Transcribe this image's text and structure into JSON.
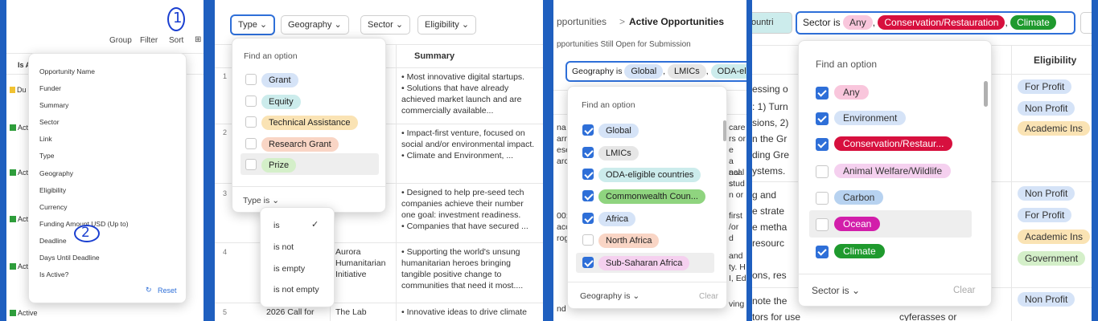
{
  "panel1": {
    "toolbar": {
      "group": "Group",
      "filter": "Filter",
      "sort": "Sort",
      "clip": "⊞"
    },
    "col_header": "Is A",
    "rows": [
      "Du",
      "Activ",
      "Activ",
      "Act",
      "Act",
      "Active"
    ],
    "menu_items": [
      "Opportunity Name",
      "Funder",
      "Summary",
      "Sector",
      "Link",
      "Type",
      "Geography",
      "Eligibility",
      "Currency",
      "Funding Amount USD (Up to)",
      "Deadline",
      "Days Until Deadline",
      "Is Active?"
    ],
    "reset": "Reset",
    "annotation1": "1",
    "annotation2": "2"
  },
  "panel2": {
    "filters": {
      "type": "Type",
      "geography": "Geography",
      "sector": "Sector",
      "eligibility": "Eligibility"
    },
    "summary_header": "Summary",
    "find_option": "Find an option",
    "options": [
      {
        "label": "Grant",
        "color": "#d5e3f7"
      },
      {
        "label": "Equity",
        "color": "#ccecec"
      },
      {
        "label": "Technical Assistance",
        "color": "#fae3b4"
      },
      {
        "label": "Research Grant",
        "color": "#f9d5c5"
      },
      {
        "label": "Prize",
        "color": "#d4efc9"
      }
    ],
    "type_is": "Type is",
    "operators": [
      "is",
      "is not",
      "is empty",
      "is not empty"
    ],
    "row_numbers": [
      "1",
      "2",
      "3",
      "4",
      "5"
    ],
    "summaries": [
      "• Most innovative digital startups.\n• Solutions that have already achieved market launch and are commercially available...",
      "• Impact-first venture, focused on social and/or environmental impact.\n• Climate and Environment, ...",
      "• Designed to help pre-seed tech companies achieve their number one goal: investment readiness.\n• Companies that have secured ...",
      "• Supporting the world's unsung humanitarian heroes bringing tangible positive change to communities that need it most....",
      "• Innovative ideas to drive climate"
    ],
    "row4_funder": "Aurora Humanitarian Initiative",
    "row5_name": "2026 Call for",
    "row5_funder": "The Lab"
  },
  "panel3": {
    "breadcrumb_prev": "pportunities",
    "breadcrumb_sep": ">",
    "breadcrumb_current": "Active Opportunities",
    "subtitle": "pportunities Still Open for Submission",
    "filter_prefix": "Geography is",
    "filter_chips": [
      "Global",
      "LMICs",
      "ODA-eli"
    ],
    "find_option": "Find an option",
    "col_frag": "ary",
    "left_frags": [
      "C",
      "na",
      "arm",
      "ese",
      "arc",
      "00:",
      "acce",
      "rog",
      "nd"
    ],
    "right_frags": [
      "care",
      "rs or",
      "e",
      "a acal",
      "nal s",
      "stud",
      "n or",
      "first",
      "/or",
      "d",
      "and",
      "ty. H",
      "I, Ed",
      "ving"
    ],
    "options": [
      {
        "label": "Global",
        "checked": true,
        "color": "#d5e3f7"
      },
      {
        "label": "LMICs",
        "checked": true,
        "color": "#e6e6e6"
      },
      {
        "label": "ODA-eligible countries",
        "checked": true,
        "color": "#ccecec"
      },
      {
        "label": "Commonwealth Coun...",
        "checked": true,
        "color": "#8fd47f"
      },
      {
        "label": "Africa",
        "checked": true,
        "color": "#d5e3f7"
      },
      {
        "label": "North Africa",
        "checked": false,
        "color": "#f9d5c5"
      },
      {
        "label": "Sub-Saharan Africa",
        "checked": true,
        "color": "#f5d0ef"
      }
    ],
    "footer_label": "Geography is",
    "clear": "Clear"
  },
  "panel4": {
    "prev_chip": "ountri",
    "filter_prefix": "Sector is",
    "filter_chips": [
      {
        "label": "Any",
        "color": "#f9c6dc"
      },
      {
        "label": "Conservation/Restauration",
        "color": "#d7103e"
      },
      {
        "label": "Climate",
        "color": "#1f9a2e"
      }
    ],
    "eligibility_header": "Eligibility",
    "find_option": "Find an option",
    "options": [
      {
        "label": "Any",
        "checked": true,
        "color": "#f9c6dc",
        "text_color": "#333"
      },
      {
        "label": "Environment",
        "checked": true,
        "color": "#d5e3f7",
        "text_color": "#333"
      },
      {
        "label": "Conservation/Restaur...",
        "checked": true,
        "color": "#d7103e",
        "text_color": "#ffffff"
      },
      {
        "label": "Animal Welfare/Wildlife",
        "checked": false,
        "color": "#f5d0ef",
        "text_color": "#333"
      },
      {
        "label": "Carbon",
        "checked": false,
        "color": "#b7d2f0",
        "text_color": "#333"
      },
      {
        "label": "Ocean",
        "checked": false,
        "color": "#d21eaa",
        "text_color": "#ffffff"
      },
      {
        "label": "Climate",
        "checked": true,
        "color": "#1f9a2e",
        "text_color": "#ffffff"
      }
    ],
    "footer_label": "Sector is",
    "clear": "Clear",
    "left_frags": [
      "essing o",
      ": 1) Turn",
      "sions, 2)",
      "n the Gr",
      "ding Gre",
      "ystems.",
      "g and",
      "e strate",
      "e metha",
      "resourc",
      "ons, res",
      "note the",
      "tors for use"
    ],
    "bottom_frag": "cyferasses or",
    "eligibility_rows": [
      {
        "label": "For Profit",
        "color": "#d5e3f7"
      },
      {
        "label": "Non Profit",
        "color": "#d5e3f7"
      },
      {
        "label": "Academic Ins",
        "color": "#fae3b4"
      },
      {
        "label": "Non Profit",
        "color": "#d5e3f7"
      },
      {
        "label": "For Profit",
        "color": "#d5e3f7"
      },
      {
        "label": "Academic Ins",
        "color": "#fae3b4"
      },
      {
        "label": "Government",
        "color": "#d4efc9"
      },
      {
        "label": "Non Profit",
        "color": "#d5e3f7"
      }
    ]
  }
}
